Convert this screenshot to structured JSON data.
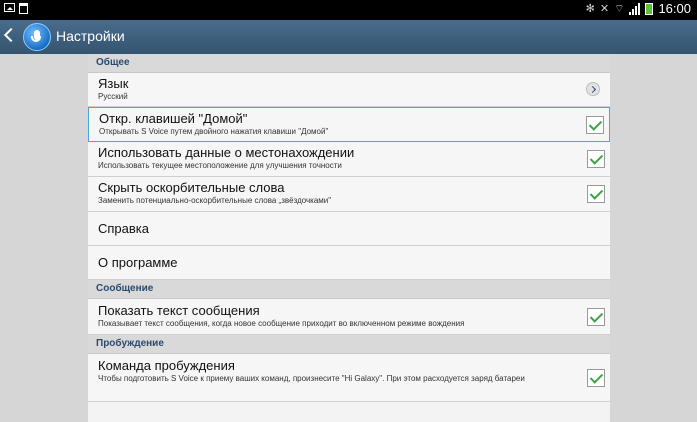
{
  "statusbar": {
    "time": "16:00"
  },
  "actionbar": {
    "title": "Настройки"
  },
  "sections": {
    "general": "Общее",
    "message": "Сообщение",
    "wakeup": "Пробуждение"
  },
  "items": {
    "language": {
      "title": "Язык",
      "sub": "Русский"
    },
    "home_key": {
      "title": "Откр. клавишей \"Домой\"",
      "sub": "Открывать S Voice путем двойного нажатия клавиши \"Домой\"",
      "checked": true
    },
    "location": {
      "title": "Использовать данные о местонахождении",
      "sub": "Использовать текущее местоположение для улучшения точности",
      "checked": true
    },
    "hide_offensive": {
      "title": "Скрыть оскорбительные слова",
      "sub": "Заменить потенциально-оскорбительные слова „звёздочками\"",
      "checked": true
    },
    "help": {
      "title": "Справка"
    },
    "about": {
      "title": "О программе"
    },
    "show_message": {
      "title": "Показать текст сообщения",
      "sub": "Показывает текст сообщения, когда новое сообщение приходит во включенном режиме вождения",
      "checked": true
    },
    "wake_command": {
      "title": "Команда пробуждения",
      "sub": "Чтобы подготовить S Voice к приему ваших команд, произнесите \"Hi Galaxy\". При этом расходуется заряд батареи",
      "checked": true
    }
  }
}
